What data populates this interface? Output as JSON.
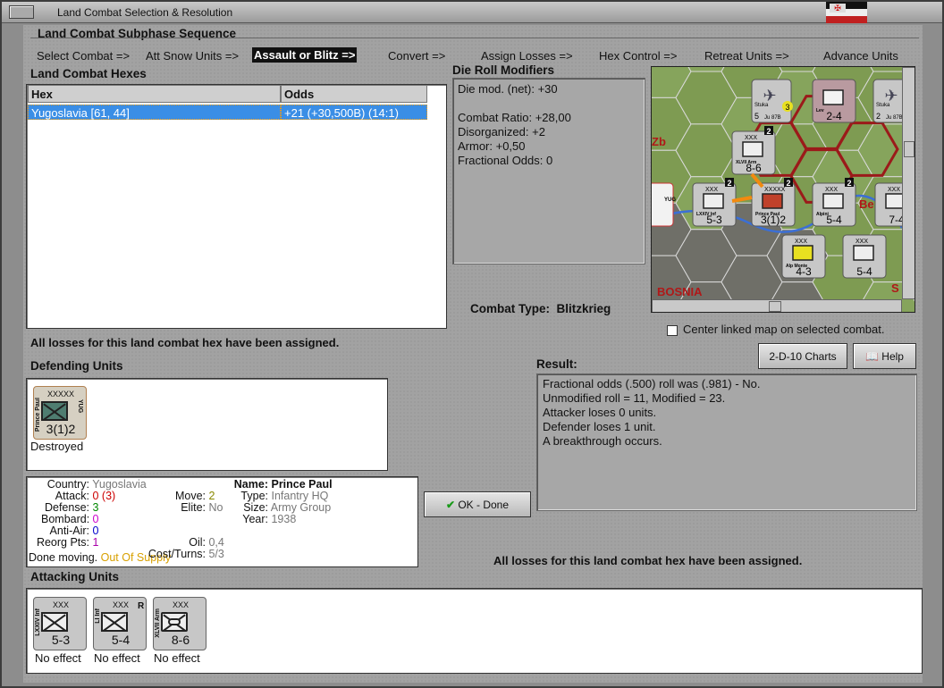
{
  "window": {
    "title": "Land Combat Selection & Resolution"
  },
  "sequence": {
    "heading": "Land Combat Subphase Sequence",
    "steps": [
      "Select Combat =>",
      "Att Snow Units =>",
      "Assault or Blitz =>",
      "Convert =>",
      "Assign Losses =>",
      "Hex Control =>",
      "Retreat Units =>",
      "Advance Units"
    ],
    "current_index": 2
  },
  "hexes": {
    "heading": "Land Combat Hexes",
    "col_hex": "Hex",
    "col_odds": "Odds",
    "rows": [
      {
        "hex": "Yugoslavia [61, 44]",
        "odds": "+21 (+30,500B) (14:1)"
      }
    ]
  },
  "modifiers": {
    "heading": "Die Roll Modifiers",
    "lines": [
      "Die mod. (net): +30",
      "",
      "Combat Ratio: +28,00",
      "Disorganized: +2",
      "Armor: +0,50",
      "Fractional Odds: 0"
    ]
  },
  "combat_type": {
    "label": "Combat Type:",
    "value": "Blitzkrieg"
  },
  "center_map": {
    "label": "Center linked map on selected combat.",
    "checked": false
  },
  "losses_msg": "All losses for this land combat hex have been assigned.",
  "buttons": {
    "charts": "2-D-10 Charts",
    "help": "Help",
    "ok": "OK - Done"
  },
  "result": {
    "heading": "Result:",
    "lines": [
      "Fractional odds (.500) roll was (.981)  - No.",
      "Unmodified roll = 11, Modified = 23.",
      "Attacker loses 0 units.",
      "Defender loses 1 unit.",
      "A breakthrough occurs."
    ]
  },
  "defending": {
    "heading": "Defending Units",
    "units": [
      {
        "size": "XXXXX",
        "name": "Prince Paul",
        "nation": "YUG",
        "value": "3(1)2",
        "status": "Destroyed"
      }
    ]
  },
  "details": {
    "country_k": "Country:",
    "country": "Yugoslavia",
    "attack_k": "Attack:",
    "attack": "0",
    "attack_paren": "(3)",
    "defense_k": "Defense:",
    "defense": "3",
    "bombard_k": "Bombard:",
    "bombard": "0",
    "antiair_k": "Anti-Air:",
    "antiair": "0",
    "reorg_k": "Reorg Pts:",
    "reorg": "1",
    "move_k": "Move:",
    "move": "2",
    "elite_k": "Elite:",
    "elite": "No",
    "oil_k": "Oil:",
    "oil": "0,4",
    "cost_k": "Cost/Turns:",
    "cost": "5/3",
    "done_k": "Done moving.",
    "supply": "Out Of Supply",
    "name_k": "Name:",
    "name": "Prince Paul",
    "type_k": "Type:",
    "type": "Infantry HQ",
    "sizek": "Size:",
    "size": "Army Group",
    "year_k": "Year:",
    "year": "1938"
  },
  "attacking": {
    "heading": "Attacking Units",
    "units": [
      {
        "size": "XXX",
        "name": "LXXIV Inf",
        "value": "5-3",
        "status": "No effect"
      },
      {
        "size": "XXX",
        "name": "LI Inf",
        "value": "5-4",
        "status": "No effect",
        "badge": "R"
      },
      {
        "size": "XXX",
        "name": "XLVII Arm",
        "value": "8-6",
        "status": "No effect"
      }
    ]
  },
  "map": {
    "labels": [
      "BOSNIA",
      "Zb",
      "Be",
      "S"
    ],
    "counters": [
      "5-3",
      "3(1)2",
      "5-4",
      "7-4",
      "8-6",
      "4-3",
      "5-4",
      "2-4",
      "2",
      "2",
      "2",
      "2",
      "2"
    ],
    "air": [
      "Stuka",
      "Ju 87B",
      "Stuka",
      "Ju 87B"
    ],
    "air_values": [
      "5",
      "3",
      "2"
    ],
    "map_text": [
      "XXX",
      "XXX",
      "XXX",
      "XXX",
      "XXX",
      "XXX",
      "XXXXX",
      "XXX",
      "XXX",
      "XXX",
      "YUG",
      "YUG",
      "XLVII Arm",
      "LXXIV Inf",
      "Alpini",
      "Alp Monte",
      "Prince Paul",
      "Lev",
      "RSM",
      "YUG",
      "1"
    ],
    "map_headers": [
      "XXX",
      "XXX",
      "XXX",
      "XXX",
      "XXX",
      "XXX",
      "XXXXX"
    ],
    "map_names": [
      "XLVII Arm",
      "LXXIV Inf",
      "Alpini",
      "Alp Monte",
      "Prince Paul",
      "Lev"
    ],
    "map_misc": [
      "YUG",
      "RSM",
      "YUG",
      "1"
    ]
  }
}
